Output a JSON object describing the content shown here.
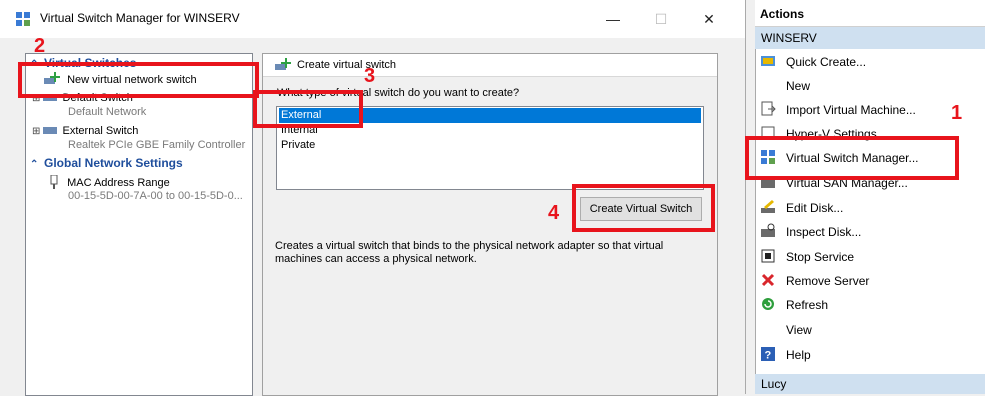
{
  "dialog": {
    "title": "Virtual Switch Manager for WINSERV",
    "controls": {
      "minimize": "—",
      "maximize": "☐",
      "close": "✕"
    }
  },
  "tree": {
    "virtual_switches_header": "Virtual Switches",
    "new_switch": "New virtual network switch",
    "default_switch": "Default Switch",
    "default_switch_sub": "Default Network",
    "external_switch": "External Switch",
    "external_switch_sub": "Realtek PCIe GBE Family Controller",
    "global_header": "Global Network Settings",
    "mac_range": "MAC Address Range",
    "mac_range_sub": "00-15-5D-00-7A-00 to 00-15-5D-0..."
  },
  "create": {
    "group_title": "Create virtual switch",
    "question": "What type of virtual switch do you want to create?",
    "options": [
      "External",
      "Internal",
      "Private"
    ],
    "selected": "External",
    "button": "Create Virtual Switch",
    "description_line1": "Creates a virtual switch that binds to the physical network adapter so that virtual",
    "description_line2": "machines can access a physical network."
  },
  "actions": {
    "header": "Actions",
    "server": "WINSERV",
    "items": [
      {
        "label": "Quick Create...",
        "icon": "quick-create-icon"
      },
      {
        "label": "New",
        "icon": "none"
      },
      {
        "label": "Import Virtual Machine...",
        "icon": "import-icon"
      },
      {
        "label": "Hyper-V Settings...",
        "icon": "settings-icon"
      },
      {
        "label": "Virtual Switch Manager...",
        "icon": "switch-manager-icon"
      },
      {
        "label": "Virtual SAN Manager...",
        "icon": "san-icon"
      },
      {
        "label": "Edit Disk...",
        "icon": "edit-disk-icon"
      },
      {
        "label": "Inspect Disk...",
        "icon": "inspect-disk-icon"
      },
      {
        "label": "Stop Service",
        "icon": "stop-icon"
      },
      {
        "label": "Remove Server",
        "icon": "remove-icon"
      },
      {
        "label": "Refresh",
        "icon": "refresh-icon"
      },
      {
        "label": "View",
        "icon": "none"
      },
      {
        "label": "Help",
        "icon": "help-icon"
      }
    ],
    "footer": "Lucy"
  },
  "annotations": {
    "n1": "1",
    "n2": "2",
    "n3": "3",
    "n4": "4"
  },
  "colors": {
    "annotation": "#e8141c",
    "selection": "#0078d7",
    "header_link": "#1f4e9c"
  }
}
